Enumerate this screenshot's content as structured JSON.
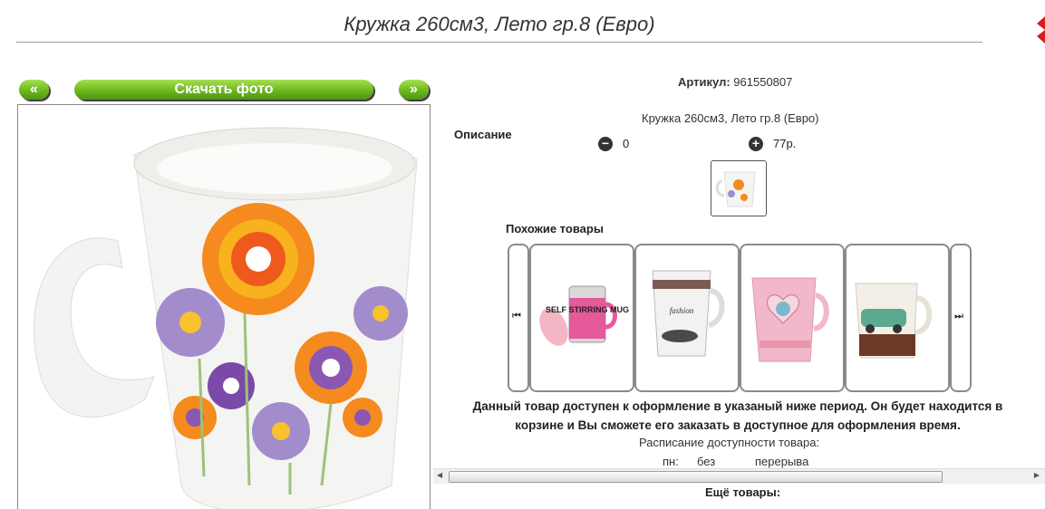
{
  "product": {
    "title": "Кружка 260см3, Лето гр.8 (Евро)",
    "artikul_label": "Артикул:",
    "artikul_value": "961550807",
    "description_label": "Описание",
    "description_text": "Кружка 260см3, Лето гр.8 (Евро)",
    "quantity": "0",
    "price": "77р."
  },
  "gallery": {
    "prev_label": "«",
    "download_label": "Скачать фото",
    "next_label": "»"
  },
  "similar": {
    "label": "Похожие товары",
    "items": [
      {
        "text": "SELF STIRRING MUG"
      },
      {
        "text": "fashion"
      },
      {
        "text": ""
      },
      {
        "text": ""
      }
    ]
  },
  "notice": {
    "text": "Данный товар доступен к оформление в указаный ниже период. Он будет находится в корзине и Вы сможете его заказать в доступное для оформления время.",
    "schedule_title": "Расписание доступности товара:",
    "day": "пн:",
    "from": "без",
    "to": "перерыва"
  },
  "more_label": "Ещё товары:",
  "colors": {
    "accent_green": "#6cb71c",
    "close_red": "#d41f1f"
  }
}
